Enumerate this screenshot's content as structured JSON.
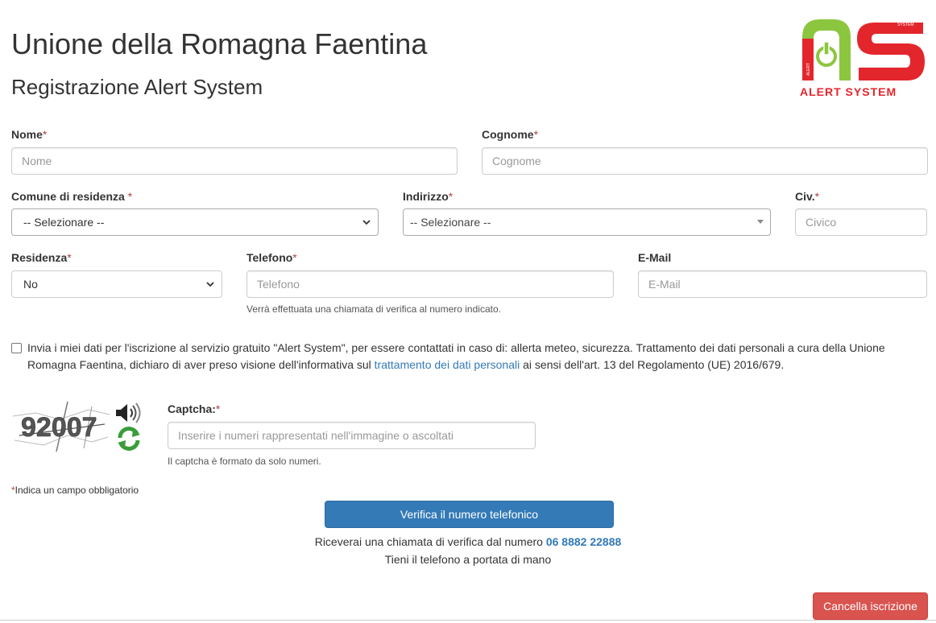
{
  "header": {
    "title": "Unione della Romagna Faentina",
    "subtitle": "Registrazione Alert System"
  },
  "logo": {
    "text_main": "ALERT SYSTEM",
    "text_side": "ALERT",
    "text_top": "SYSTEM",
    "colors": {
      "red": "#e3262c",
      "green": "#8cc63f",
      "grey": "#9a9a9a"
    }
  },
  "form": {
    "required_marker": "*",
    "nome": {
      "label": "Nome",
      "placeholder": "Nome",
      "value": ""
    },
    "cognome": {
      "label": "Cognome",
      "placeholder": "Cognome",
      "value": ""
    },
    "comune": {
      "label": "Comune di residenza",
      "selected": "-- Selezionare --"
    },
    "indirizzo": {
      "label": "Indirizzo",
      "selected": "-- Selezionare --"
    },
    "civico": {
      "label": "Civ.",
      "placeholder": "Civico",
      "value": ""
    },
    "residenza": {
      "label": "Residenza",
      "selected": "No"
    },
    "telefono": {
      "label": "Telefono",
      "placeholder": "Telefono",
      "value": "",
      "help": "Verrà effettuata una chiamata di verifica al numero indicato."
    },
    "email": {
      "label": "E-Mail",
      "placeholder": "E-Mail",
      "value": ""
    },
    "consent": {
      "checked": false,
      "text_before": "Invia i miei dati per l'iscrizione al servizio gratuito \"Alert System\", per essere contattati in caso di: allerta meteo, sicurezza. Trattamento dei dati personali a cura della Unione Romagna Faentina, dichiaro di aver preso visione dell'informativa sul ",
      "link_text": "trattamento dei dati personali",
      "text_after": " ai sensi dell'art. 13 del Regolamento (UE) 2016/679."
    },
    "captcha": {
      "image_text": "92007",
      "label": "Captcha:",
      "placeholder": "Inserire i numeri rappresentati nell'immagine o ascoltati",
      "value": "",
      "help": "Il captcha è formato da solo numeri."
    },
    "required_note": "Indica un campo obbligatorio"
  },
  "actions": {
    "verify_button": "Verifica il numero telefonico",
    "call_info_prefix": "Riceverai una chiamata di verifica dal numero ",
    "call_number": "06 8882 22888",
    "call_info_line2": "Tieni il telefono a portata di mano",
    "cancel_button": "Cancella iscrizione"
  }
}
